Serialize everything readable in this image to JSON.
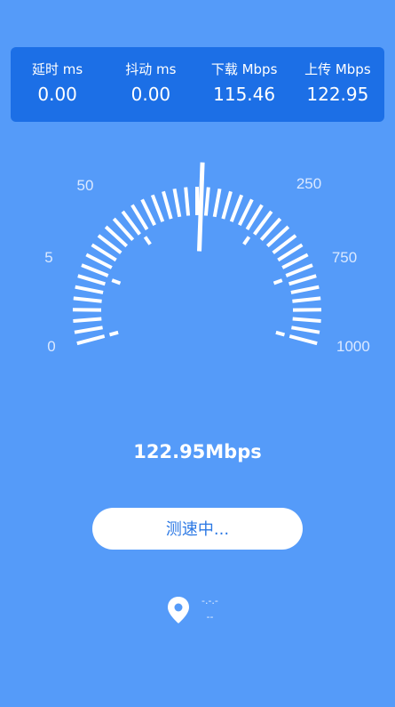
{
  "stats": [
    {
      "label": "延时 ms",
      "value": "0.00"
    },
    {
      "label": "抖动 ms",
      "value": "0.00"
    },
    {
      "label": "下载 Mbps",
      "value": "115.46"
    },
    {
      "label": "上传 Mbps",
      "value": "122.95"
    }
  ],
  "gauge": {
    "scale_labels": [
      "0",
      "5",
      "50",
      "250",
      "750",
      "1000"
    ],
    "needle_fraction": 0.51
  },
  "speed_readout": "122.95Mbps",
  "status_button": "测速中...",
  "location": {
    "line1": "-.-.-",
    "line2": "--"
  },
  "colors": {
    "background": "#559bf9",
    "panel": "#1c6fe6",
    "button_text": "#2b78e4"
  },
  "icons": {
    "location": "location-pin-icon"
  }
}
